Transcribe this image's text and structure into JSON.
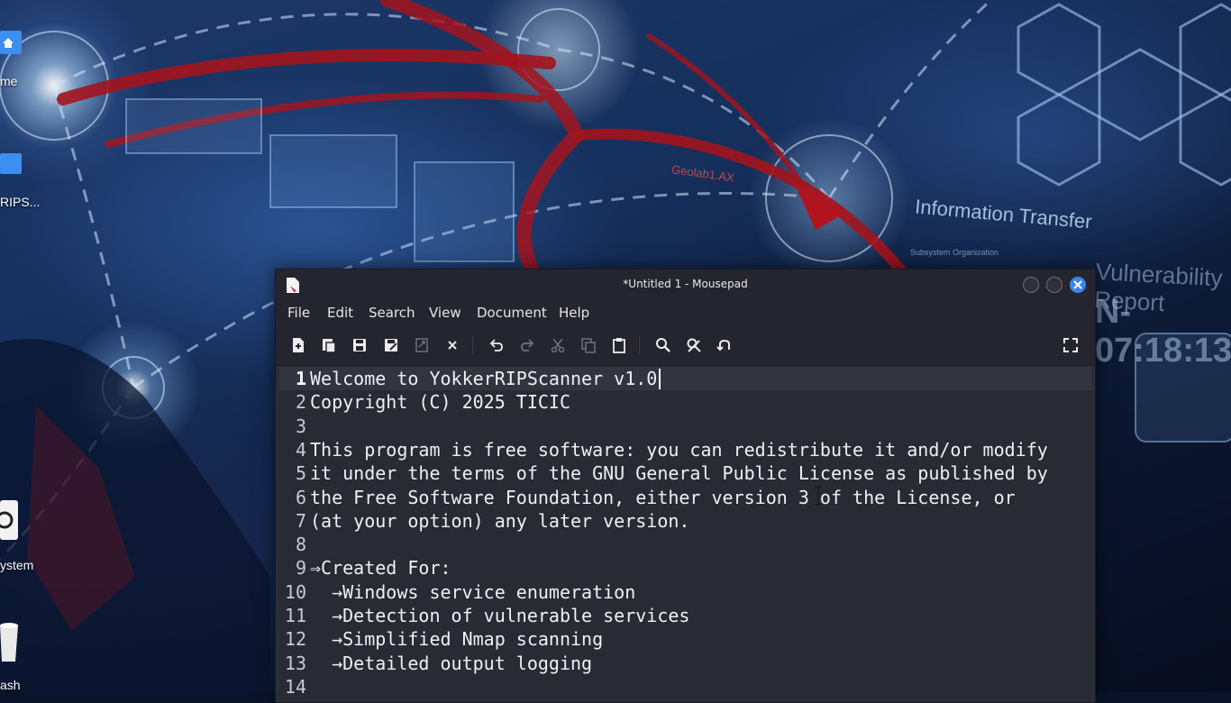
{
  "desktop": {
    "icons": [
      {
        "label": "me",
        "icon": "home-folder-icon"
      },
      {
        "label": "RIPS...",
        "icon": "folder-icon"
      },
      {
        "label": "ystem",
        "icon": "file-system-icon"
      },
      {
        "label": "ash",
        "icon": "trash-icon"
      }
    ],
    "wallpaper_text": [
      "Information Transfer",
      "Vulnerability Report",
      "N-07:18:13",
      "Geolab1.AX",
      "Subsystem Organization"
    ]
  },
  "window": {
    "title": "*Untitled 1 - Mousepad",
    "menu": [
      "File",
      "Edit",
      "Search",
      "View",
      "Document",
      "Help"
    ],
    "toolbar_icons": [
      "new-document-icon",
      "new-window-icon",
      "save-icon",
      "save-as-icon",
      "reload-icon",
      "close-document-icon",
      "undo-icon",
      "redo-icon",
      "cut-icon",
      "copy-icon",
      "paste-icon",
      "find-icon",
      "find-replace-icon",
      "go-to-line-icon",
      "fullscreen-icon"
    ],
    "accent": "#3c85e8"
  },
  "editor": {
    "lines": [
      {
        "num": "1",
        "text": "Welcome to YokkerRIPScanner v1.0"
      },
      {
        "num": "2",
        "text": "Copyright (C) 2025 TICIC"
      },
      {
        "num": "3",
        "text": ""
      },
      {
        "num": "4",
        "text": "This program is free software: you can redistribute it and/or modify"
      },
      {
        "num": "5",
        "text": "it under the terms of the GNU General Public License as published by"
      },
      {
        "num": "6",
        "text": "the Free Software Foundation, either version 3 of the License, or"
      },
      {
        "num": "7",
        "text": "(at your option) any later version."
      },
      {
        "num": "8",
        "text": ""
      },
      {
        "num": "9",
        "text": "⇒Created For:"
      },
      {
        "num": "10",
        "text": "  →Windows service enumeration"
      },
      {
        "num": "11",
        "text": "  →Detection of vulnerable services"
      },
      {
        "num": "12",
        "text": "  →Simplified Nmap scanning"
      },
      {
        "num": "13",
        "text": "  →Detailed output logging"
      },
      {
        "num": "14",
        "text": ""
      }
    ],
    "current_line": 1
  }
}
